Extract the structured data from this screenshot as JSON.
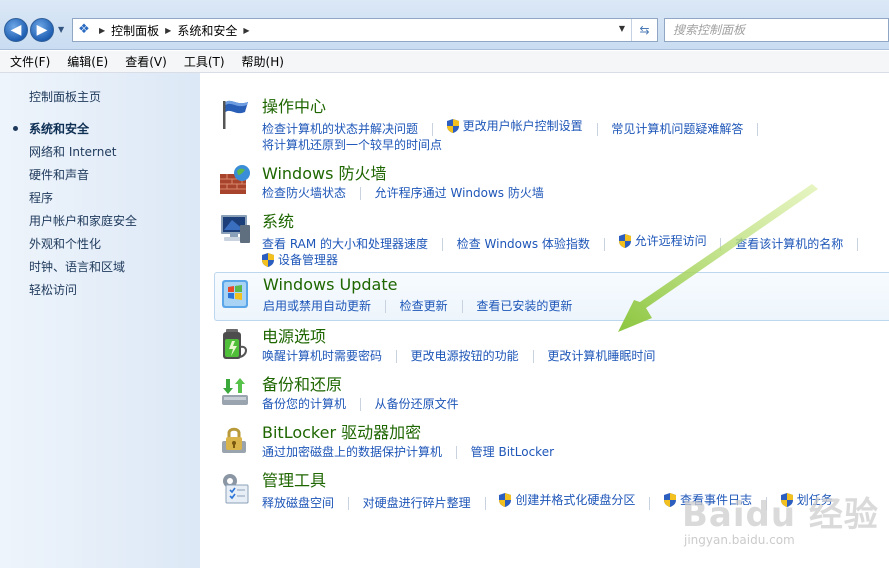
{
  "address_bar": {
    "breadcrumbs": [
      "控制面板",
      "系统和安全"
    ],
    "search_placeholder": "搜索控制面板"
  },
  "menu": [
    "文件(F)",
    "编辑(E)",
    "查看(V)",
    "工具(T)",
    "帮助(H)"
  ],
  "sidebar": {
    "home": "控制面板主页",
    "items": [
      {
        "label": "系统和安全",
        "active": true
      },
      {
        "label": "网络和 Internet",
        "active": false
      },
      {
        "label": "硬件和声音",
        "active": false
      },
      {
        "label": "程序",
        "active": false
      },
      {
        "label": "用户帐户和家庭安全",
        "active": false
      },
      {
        "label": "外观和个性化",
        "active": false
      },
      {
        "label": "时钟、语言和区域",
        "active": false
      },
      {
        "label": "轻松访问",
        "active": false
      }
    ]
  },
  "categories": [
    {
      "title": "操作中心",
      "icon": "flag-icon",
      "links": [
        {
          "text": "检查计算机的状态并解决问题",
          "shield": false
        },
        {
          "text": "更改用户帐户控制设置",
          "shield": true
        },
        {
          "text": "常见计算机问题疑难解答",
          "shield": false
        }
      ],
      "links2": [
        {
          "text": "将计算机还原到一个较早的时间点",
          "shield": false
        }
      ]
    },
    {
      "title": "Windows 防火墙",
      "icon": "firewall-icon",
      "links": [
        {
          "text": "检查防火墙状态",
          "shield": false
        },
        {
          "text": "允许程序通过 Windows 防火墙",
          "shield": false
        }
      ],
      "links2": []
    },
    {
      "title": "系统",
      "icon": "system-icon",
      "links": [
        {
          "text": "查看 RAM 的大小和处理器速度",
          "shield": false
        },
        {
          "text": "检查 Windows 体验指数",
          "shield": false
        },
        {
          "text": "允许远程访问",
          "shield": true
        },
        {
          "text": "查看该计算机的名称",
          "shield": false
        }
      ],
      "links2": [
        {
          "text": "设备管理器",
          "shield": true
        }
      ]
    },
    {
      "title": "Windows Update",
      "icon": "windows-update-icon",
      "links": [
        {
          "text": "启用或禁用自动更新",
          "shield": false
        },
        {
          "text": "检查更新",
          "shield": false
        },
        {
          "text": "查看已安装的更新",
          "shield": false
        }
      ],
      "links2": []
    },
    {
      "title": "电源选项",
      "icon": "battery-icon",
      "links": [
        {
          "text": "唤醒计算机时需要密码",
          "shield": false
        },
        {
          "text": "更改电源按钮的功能",
          "shield": false
        },
        {
          "text": "更改计算机睡眠时间",
          "shield": false
        }
      ],
      "links2": []
    },
    {
      "title": "备份和还原",
      "icon": "backup-icon",
      "links": [
        {
          "text": "备份您的计算机",
          "shield": false
        },
        {
          "text": "从备份还原文件",
          "shield": false
        }
      ],
      "links2": []
    },
    {
      "title": "BitLocker 驱动器加密",
      "icon": "bitlocker-icon",
      "links": [
        {
          "text": "通过加密磁盘上的数据保护计算机",
          "shield": false
        },
        {
          "text": "管理 BitLocker",
          "shield": false
        }
      ],
      "links2": []
    },
    {
      "title": "管理工具",
      "icon": "admin-tools-icon",
      "links": [
        {
          "text": "释放磁盘空间",
          "shield": false
        },
        {
          "text": "对硬盘进行碎片整理",
          "shield": false
        },
        {
          "text": "创建并格式化硬盘分区",
          "shield": true
        },
        {
          "text": "查看事件日志",
          "shield": true
        },
        {
          "text": "划任务",
          "shield": true
        }
      ],
      "links2": []
    }
  ],
  "watermark": {
    "logo": "Baidu 经验",
    "sub": "jingyan.baidu.com"
  },
  "colors": {
    "title_green": "#1e6600",
    "link_blue": "#1e56b8",
    "arrow_green": "#8cc63f"
  }
}
